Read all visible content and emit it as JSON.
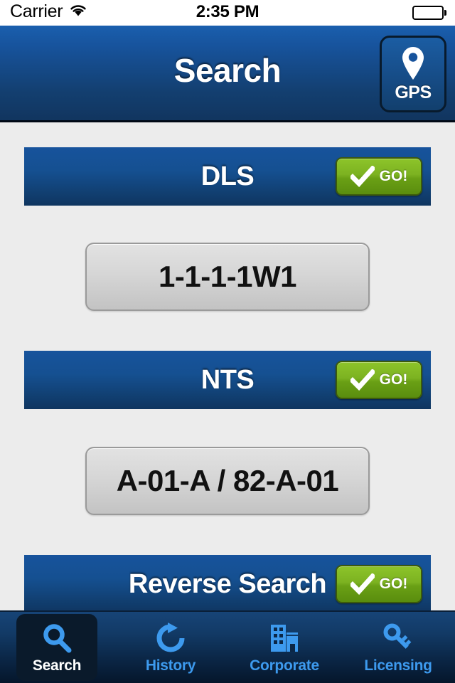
{
  "statusbar": {
    "carrier": "Carrier",
    "wifi_icon": "wifi-icon",
    "time": "2:35 PM",
    "battery_icon": "battery-full-icon"
  },
  "header": {
    "title": "Search",
    "gps_button": {
      "label": "GPS",
      "icon": "map-pin-icon"
    }
  },
  "sections": [
    {
      "title": "DLS",
      "go_label": "GO!",
      "go_icon": "checkmark-icon",
      "value": "1-1-1-1W1"
    },
    {
      "title": "NTS",
      "go_label": "GO!",
      "go_icon": "checkmark-icon",
      "value": "A-01-A / 82-A-01"
    },
    {
      "title": "Reverse Search",
      "go_label": "GO!",
      "go_icon": "checkmark-icon",
      "value": ""
    }
  ],
  "tabbar": {
    "items": [
      {
        "label": "Search",
        "icon": "magnifier-icon",
        "active": true
      },
      {
        "label": "History",
        "icon": "refresh-arrow-icon",
        "active": false
      },
      {
        "label": "Corporate",
        "icon": "buildings-icon",
        "active": false
      },
      {
        "label": "Licensing",
        "icon": "key-icon",
        "active": false
      }
    ]
  },
  "colors": {
    "page_background": "#ececec",
    "header_blue_top": "#1a5fae",
    "header_blue_bottom": "#11355f",
    "section_blue_top": "#17539c",
    "section_blue_bottom": "#0f3560",
    "go_green_top": "#8dc42a",
    "go_green_bottom": "#5a8d0e",
    "tab_icon_blue": "#3d9aee",
    "tabbar_top": "#174477",
    "tabbar_bottom": "#05162b"
  }
}
